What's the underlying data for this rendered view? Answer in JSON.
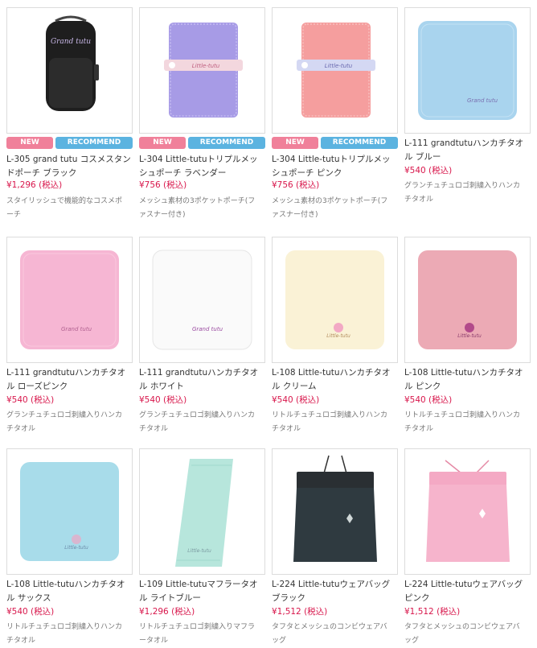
{
  "badges": {
    "new": "NEW",
    "recommend": "RECOMMEND"
  },
  "products": [
    {
      "title": "L-305 grand tutu コスメスタンドポーチ ブラック",
      "price": "¥1,296 (税込)",
      "desc": "スタイリッシュで機能的なコスメポーチ",
      "image": "black-cosmetic-pouch",
      "new": true,
      "recommend": true
    },
    {
      "title": "L-304 Little-tutuトリプルメッシュポーチ ラベンダー",
      "price": "¥756 (税込)",
      "desc": "メッシュ素材の3ポケットポーチ(ファスナー付き)",
      "image": "lavender-mesh-pouch",
      "new": true,
      "recommend": true
    },
    {
      "title": "L-304 Little-tutuトリプルメッシュポーチ ピンク",
      "price": "¥756 (税込)",
      "desc": "メッシュ素材の3ポケットポーチ(ファスナー付き)",
      "image": "pink-mesh-pouch",
      "new": true,
      "recommend": true
    },
    {
      "title": "L-111 grandtutuハンカチタオル ブルー",
      "price": "¥540 (税込)",
      "desc": "グランチュチュロゴ刺繍入りハンカチタオル",
      "image": "blue-towel",
      "new": false,
      "recommend": false
    },
    {
      "title": "L-111 grandtutuハンカチタオル ローズピンク",
      "price": "¥540 (税込)",
      "desc": "グランチュチュロゴ刺繍入りハンカチタオル",
      "image": "rose-pink-towel",
      "new": false,
      "recommend": false
    },
    {
      "title": "L-111 grandtutuハンカチタオル ホワイト",
      "price": "¥540 (税込)",
      "desc": "グランチュチュロゴ刺繍入りハンカチタオル",
      "image": "white-towel",
      "new": false,
      "recommend": false
    },
    {
      "title": "L-108 Little-tutuハンカチタオル クリーム",
      "price": "¥540 (税込)",
      "desc": "リトルチュチュロゴ刺繍入りハンカチタオル",
      "image": "cream-towel",
      "new": false,
      "recommend": false
    },
    {
      "title": "L-108 Little-tutuハンカチタオル ピンク",
      "price": "¥540 (税込)",
      "desc": "リトルチュチュロゴ刺繍入りハンカチタオル",
      "image": "pink-towel",
      "new": false,
      "recommend": false
    },
    {
      "title": "L-108 Little-tutuハンカチタオル サックス",
      "price": "¥540 (税込)",
      "desc": "リトルチュチュロゴ刺繍入りハンカチタオル",
      "image": "sax-towel",
      "new": false,
      "recommend": false
    },
    {
      "title": "L-109 Little-tutuマフラータオル ライトブルー",
      "price": "¥1,296 (税込)",
      "desc": "リトルチュチュロゴ刺繍入りマフラータオル",
      "image": "light-blue-muffler-towel",
      "new": false,
      "recommend": false
    },
    {
      "title": "L-224 Little-tutuウェアバッグ ブラック",
      "price": "¥1,512 (税込)",
      "desc": "タフタとメッシュのコンビウェアバッグ",
      "image": "black-wear-bag",
      "new": false,
      "recommend": false
    },
    {
      "title": "L-224 Little-tutuウェアバッグ ピンク",
      "price": "¥1,512 (税込)",
      "desc": "タフタとメッシュのコンビウェアバッグ",
      "image": "pink-wear-bag",
      "new": false,
      "recommend": false
    }
  ],
  "colors": {
    "price": "#d8164b",
    "new_badge": "#f0809a",
    "recommend_badge": "#5bb3e0"
  }
}
